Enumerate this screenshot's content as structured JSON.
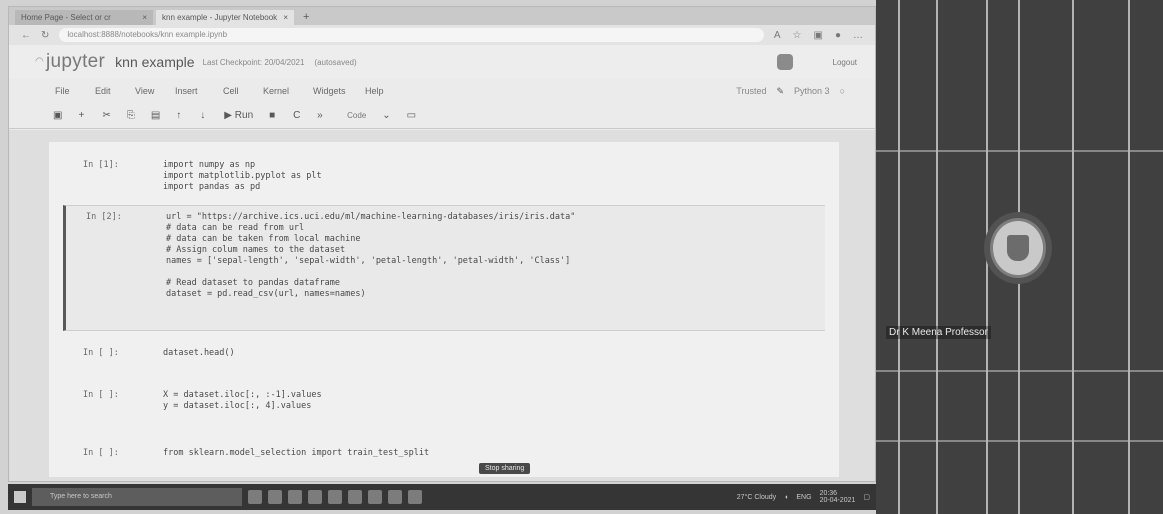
{
  "browser": {
    "tabs": [
      {
        "label": "Home Page - Select or cr",
        "active": false
      },
      {
        "label": "knn example - Jupyter Notebook",
        "active": true
      }
    ],
    "new_tab": "+",
    "url": "localhost:8888/notebooks/knn example.ipynb"
  },
  "jupyter": {
    "logo": "jupyter",
    "notebook_name": "knn example",
    "checkpoint": "Last Checkpoint: 20/04/2021",
    "autosave": "(autosaved)",
    "logout": "Logout",
    "menu": [
      "File",
      "Edit",
      "View",
      "Insert",
      "Cell",
      "Kernel",
      "Widgets",
      "Help"
    ],
    "trusted": "Trusted",
    "kernel": "Python 3",
    "toolbar_run": "Run",
    "cell_type": "Code"
  },
  "cells": [
    {
      "prompt": "In [1]:",
      "code": "import numpy as np\nimport matplotlib.pyplot as plt\nimport pandas as pd"
    },
    {
      "prompt": "In [2]:",
      "code": "url = \"https://archive.ics.uci.edu/ml/machine-learning-databases/iris/iris.data\"\n# data can be read from url\n# data can be taken from local machine\n# Assign colum names to the dataset\nnames = ['sepal-length', 'sepal-width', 'petal-length', 'petal-width', 'Class']\n\n# Read dataset to pandas dataframe\ndataset = pd.read_csv(url, names=names)"
    },
    {
      "prompt": "In [ ]:",
      "code": "dataset.head()"
    },
    {
      "prompt": "In [ ]:",
      "code": "X = dataset.iloc[:, :-1].values\ny = dataset.iloc[:, 4].values"
    },
    {
      "prompt": "In [ ]:",
      "code": "from sklearn.model_selection import train_test_split"
    }
  ],
  "shared_bar": "Stop sharing",
  "taskbar": {
    "search_placeholder": "Type here to search",
    "weather": "27°C Cloudy",
    "lang": "ENG",
    "time": "20:36",
    "date": "20-04-2021"
  },
  "video": {
    "presenter": "Dr K Meena Professor"
  }
}
